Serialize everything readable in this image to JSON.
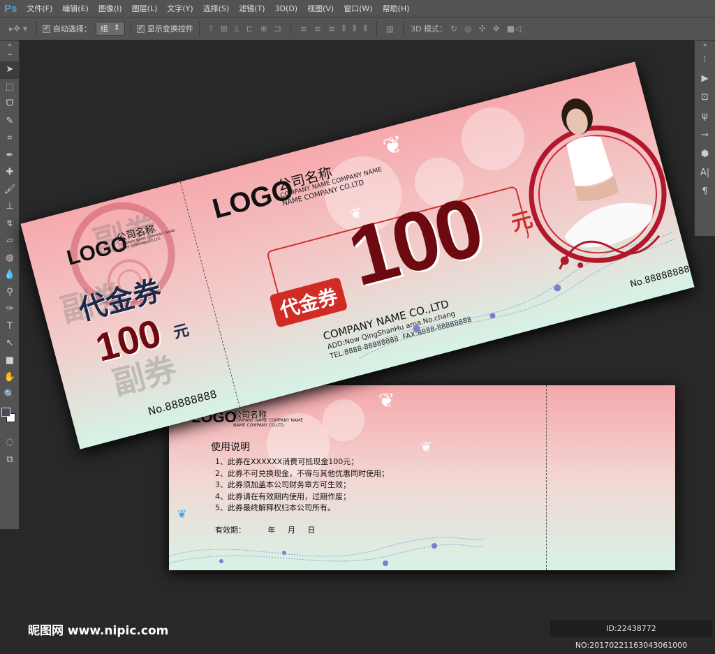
{
  "app": {
    "logo": "Ps",
    "menu": [
      "文件(F)",
      "编辑(E)",
      "图像(I)",
      "图层(L)",
      "文字(Y)",
      "选择(S)",
      "滤镜(T)",
      "3D(D)",
      "视图(V)",
      "窗口(W)",
      "帮助(H)"
    ]
  },
  "options": {
    "auto_select_label": "自动选择：",
    "auto_select_value": "组",
    "show_transform_label": "显示变换控件",
    "mode3d_label": "3D 模式："
  },
  "front": {
    "stub": {
      "logo": "LOGO",
      "company_cn": "公司名称",
      "company_en1": "COMPANY NAME COMPANY NAME",
      "company_en2": "NAME COMPANY CO.LTD",
      "title": "代金券",
      "amount": "100",
      "unit": "元",
      "number": "No.88888888",
      "watermark": "副券"
    },
    "main": {
      "logo": "LOGO",
      "company_cn": "公司名称",
      "company_en1": "COMPANY NAME COMPANY NAME",
      "company_en2": "NAME COMPANY CO.LTD",
      "badge": "代金券",
      "amount": "100",
      "unit": "元",
      "company": "COMPANY NAME CO.,LTD",
      "address": "ADD:Now QingShanHu aroa.No.chang",
      "tel": "TEL:8888-88888888",
      "fax": "FAX:8888-88888888",
      "number": "No.88888888"
    }
  },
  "back": {
    "logo": "LOGO",
    "company_cn": "公司名称",
    "company_en1": "COMPANY NAME COMPANY NAME",
    "company_en2": "NAME COMPANY CO.LTD",
    "heading": "使用说明",
    "rules": [
      "1、此券在XXXXXX消费可抵现金100元；",
      "2、此券不可兑换现金，不得与其他优惠同时使用；",
      "3、此券须加盖本公司财务章方可生效；",
      "4、此券请在有效期内使用，过期作废；",
      "5、此券最终解释权归本公司所有。"
    ],
    "validity_label": "有效期：",
    "year": "年",
    "month": "月",
    "day": "日"
  },
  "footer": {
    "site": "昵图网 www.nipic.com",
    "id": "ID:22438772 NO:20170221163043061000"
  },
  "colors": {
    "accent_red": "#d12b26",
    "dark_red": "#6d0a10",
    "navy": "#1c2a4a"
  }
}
